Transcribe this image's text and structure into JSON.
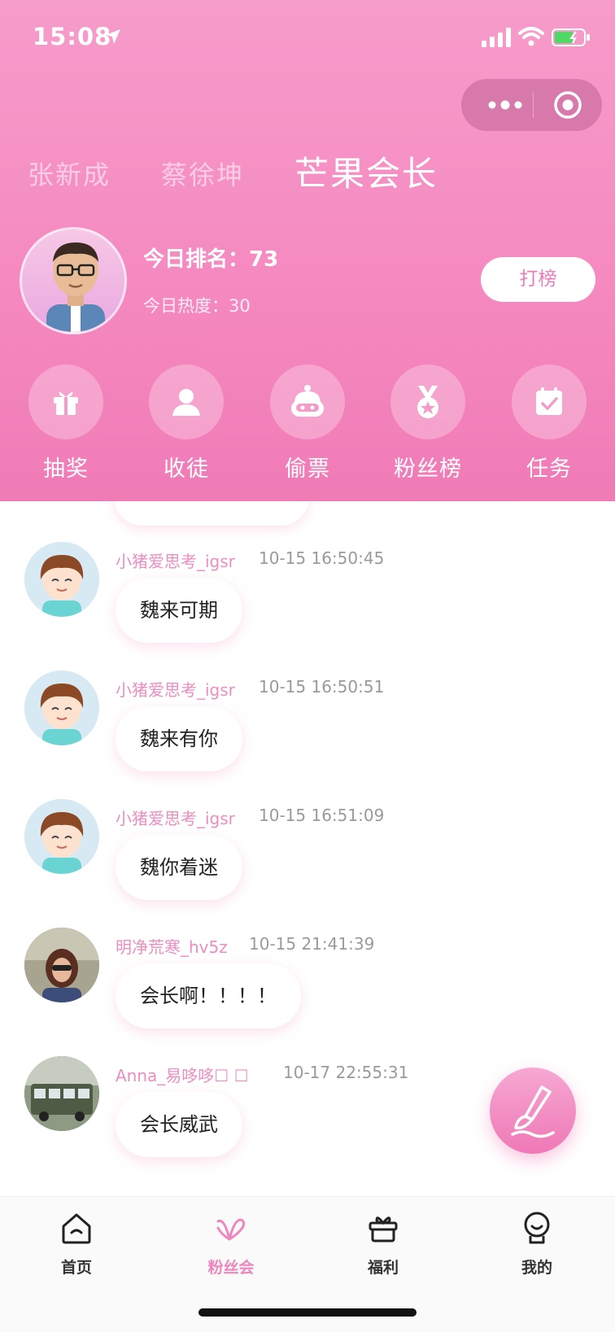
{
  "status_bar": {
    "time": "15:08"
  },
  "tabs": [
    {
      "label": "张新成",
      "active": false
    },
    {
      "label": "蔡徐坤",
      "active": false
    },
    {
      "label": "芒果会长",
      "active": true
    }
  ],
  "profile": {
    "rank_text": "今日排名：73",
    "heat_text": "今日热度：30",
    "vote_button": "打榜"
  },
  "actions": [
    {
      "label": "抽奖",
      "icon": "gift-icon"
    },
    {
      "label": "收徒",
      "icon": "person-icon"
    },
    {
      "label": "偷票",
      "icon": "robot-icon"
    },
    {
      "label": "粉丝榜",
      "icon": "medal-icon"
    },
    {
      "label": "任务",
      "icon": "calendar-check-icon"
    }
  ],
  "messages": [
    {
      "name": "小猪爱思考_igsr",
      "time": "10-15 16:50:45",
      "text": "魏来可期"
    },
    {
      "name": "小猪爱思考_igsr",
      "time": "10-15 16:50:51",
      "text": "魏来有你"
    },
    {
      "name": "小猪爱思考_igsr",
      "time": "10-15 16:51:09",
      "text": "魏你着迷"
    },
    {
      "name": "明净荒寒_hv5z",
      "time": "10-15 21:41:39",
      "text": "会长啊！！！！"
    },
    {
      "name": "Anna_易哆哆☐ ☐",
      "time": "10-17 22:55:31",
      "text": "会长威武"
    }
  ],
  "tabbar": [
    {
      "label": "首页",
      "icon": "home-icon",
      "active": false
    },
    {
      "label": "粉丝会",
      "icon": "fan-club-icon",
      "active": true
    },
    {
      "label": "福利",
      "icon": "gift-box-icon",
      "active": false
    },
    {
      "label": "我的",
      "icon": "profile-icon",
      "active": false
    }
  ],
  "colors": {
    "brand_pink": "#f58ac0",
    "accent_text": "#ef86bd"
  }
}
